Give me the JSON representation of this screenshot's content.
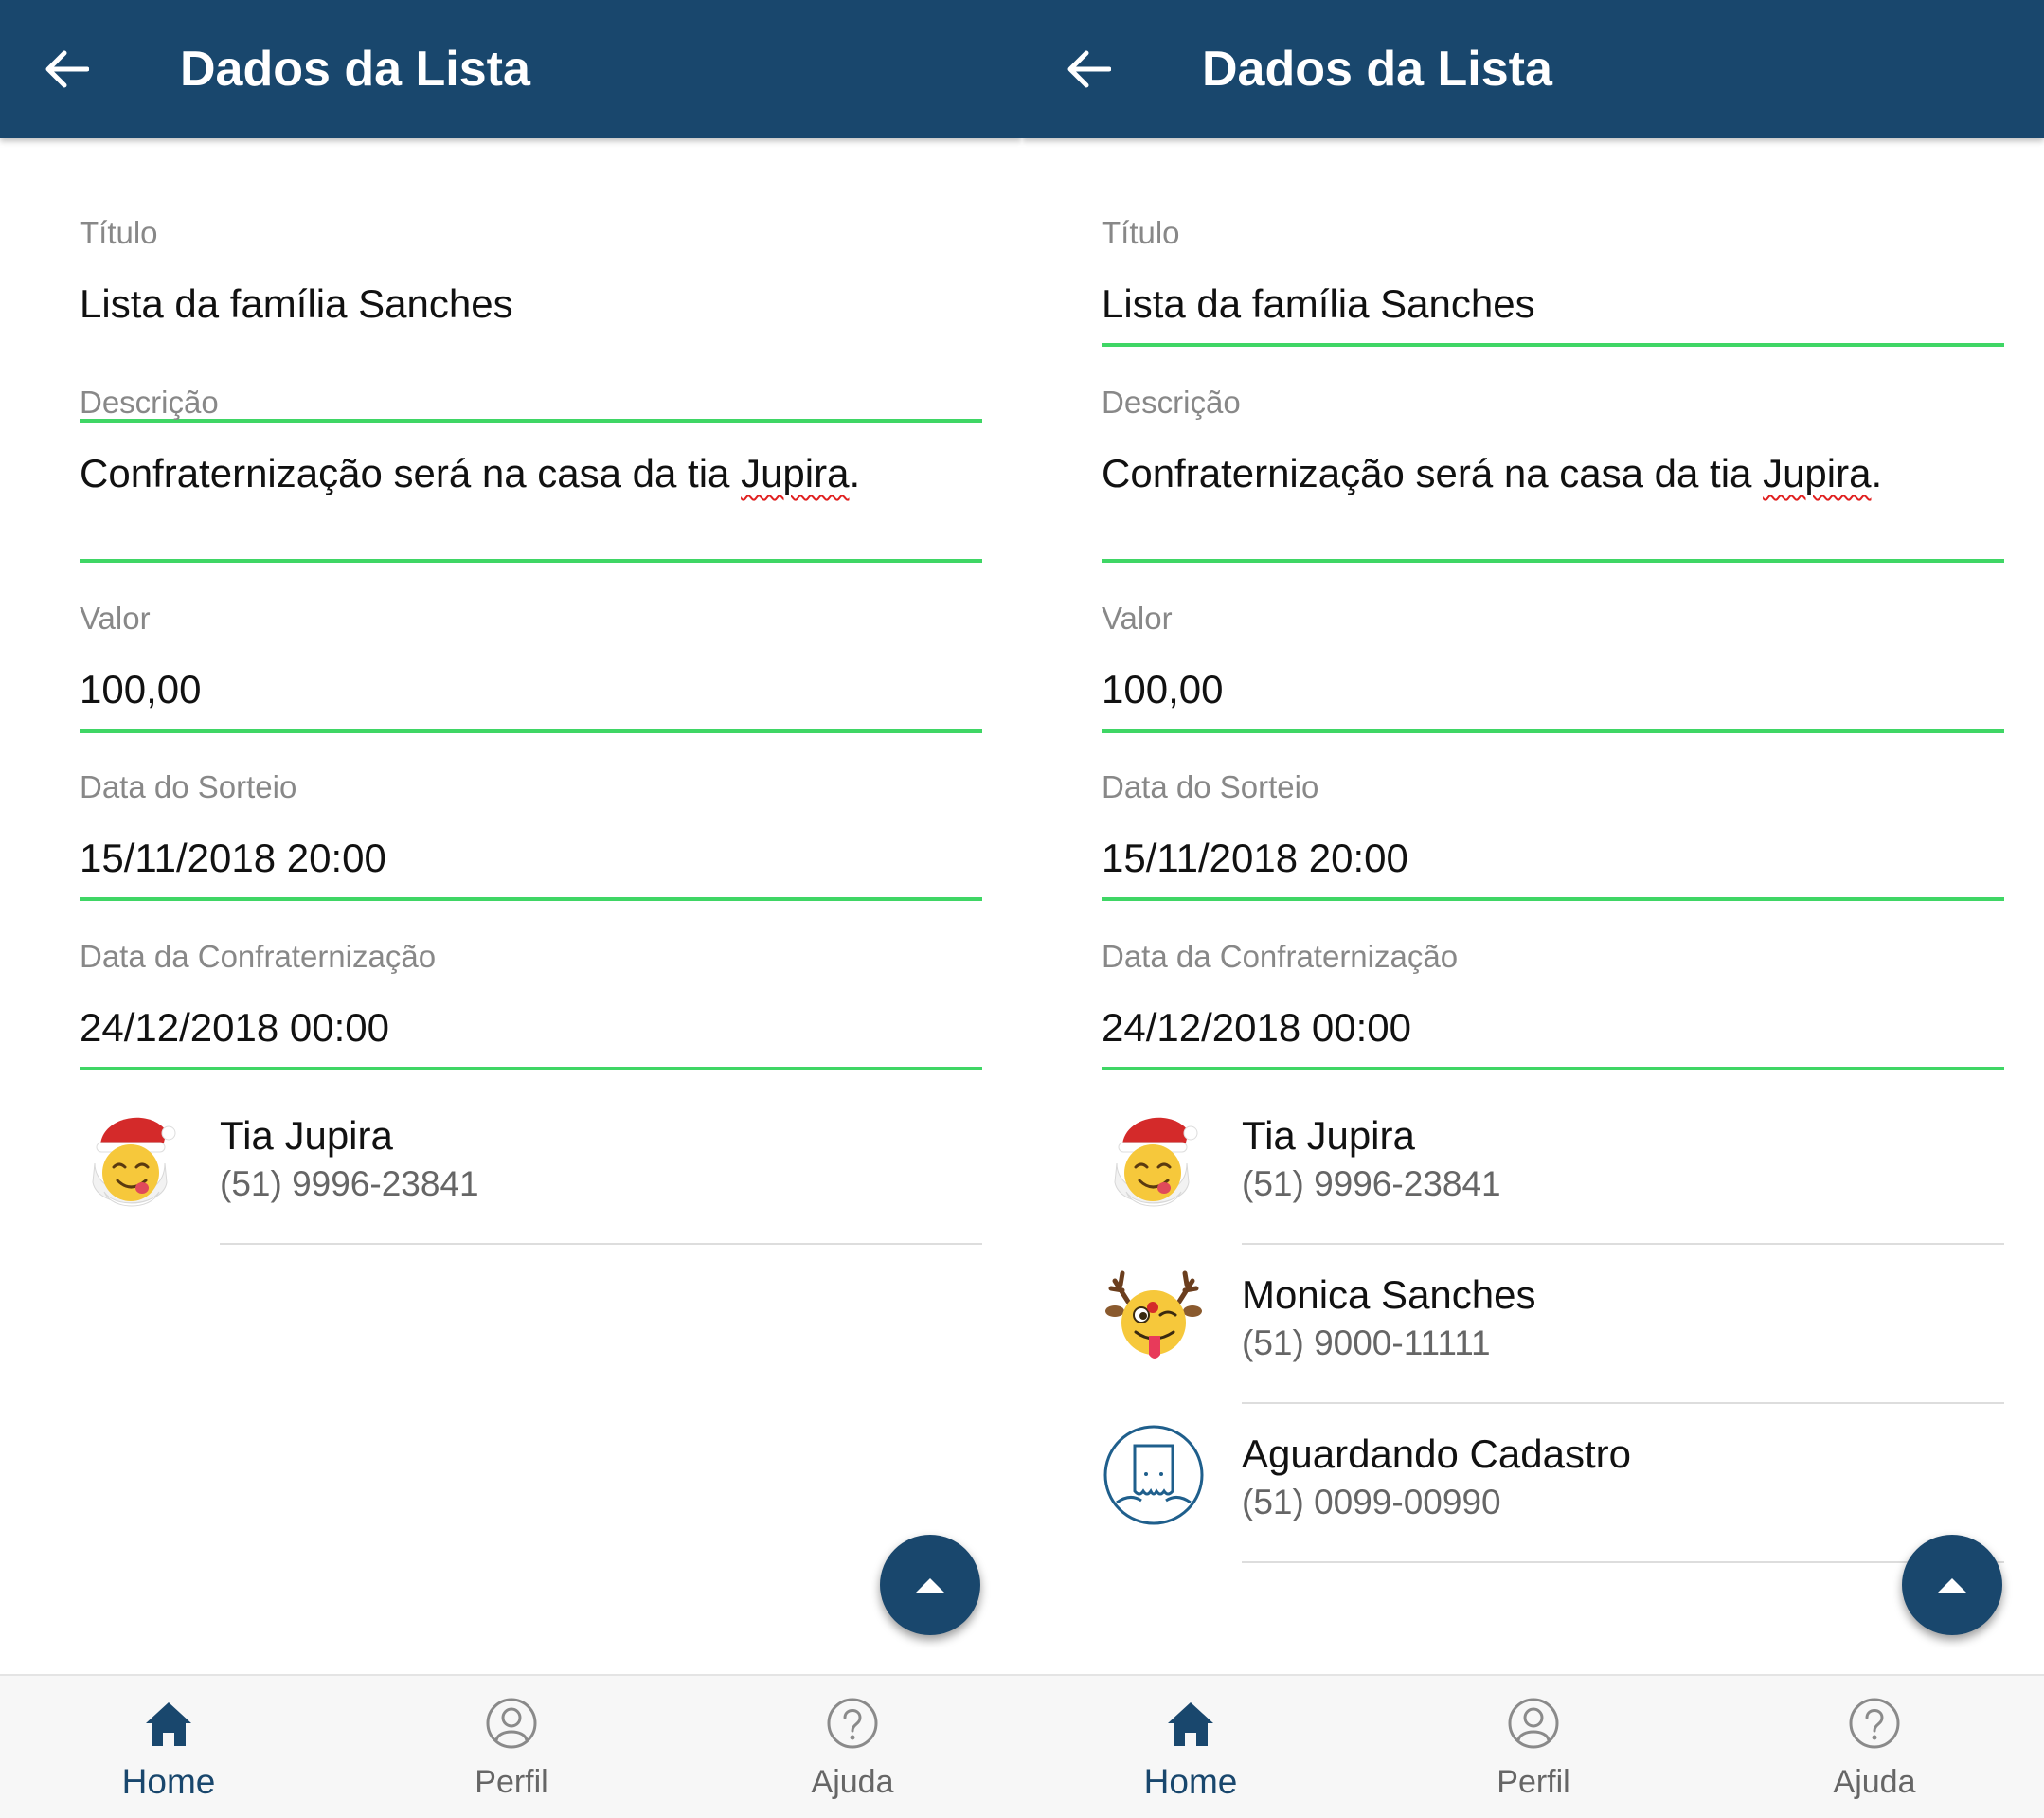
{
  "colors": {
    "appbar": "#19476d",
    "accent_underline": "#3fd665",
    "fab": "#19476d",
    "nav_active": "#19476d",
    "nav_inactive": "#666666"
  },
  "screens": [
    {
      "appbar": {
        "back_icon": "arrow-left-icon",
        "title": "Dados da Lista"
      },
      "form": {
        "titulo": {
          "label": "Título",
          "value": "Lista da família Sanches"
        },
        "descricao": {
          "label": "Descrição",
          "value_prefix": "Confraternização será na casa da tia ",
          "value_flagged": "Jupira",
          "value_suffix": "."
        },
        "valor": {
          "label": "Valor",
          "value": "100,00"
        },
        "data_sorteio": {
          "label": "Data do Sorteio",
          "value": "15/11/2018 20:00"
        },
        "data_confraternizacao": {
          "label": "Data da Confraternização",
          "value": "24/12/2018 00:00"
        }
      },
      "members": [
        {
          "name": "Tia Jupira",
          "phone": "(51) 9996-23841",
          "avatar": "santa-emoji-avatar-icon"
        }
      ],
      "fab": {
        "icon": "caret-up-icon"
      },
      "bottom_nav": [
        {
          "label": "Home",
          "icon": "home-icon",
          "active": true
        },
        {
          "label": "Perfil",
          "icon": "profile-icon",
          "active": false
        },
        {
          "label": "Ajuda",
          "icon": "help-icon",
          "active": false
        }
      ]
    },
    {
      "appbar": {
        "back_icon": "arrow-left-icon",
        "title": "Dados da Lista"
      },
      "form": {
        "titulo": {
          "label": "Título",
          "value": "Lista da família Sanches"
        },
        "descricao": {
          "label": "Descrição",
          "value_prefix": "Confraternização será na casa da tia ",
          "value_flagged": "Jupira",
          "value_suffix": "."
        },
        "valor": {
          "label": "Valor",
          "value": "100,00"
        },
        "data_sorteio": {
          "label": "Data do Sorteio",
          "value": "15/11/2018 20:00"
        },
        "data_confraternizacao": {
          "label": "Data da Confraternização",
          "value": "24/12/2018 00:00"
        }
      },
      "members": [
        {
          "name": "Tia Jupira",
          "phone": "(51) 9996-23841",
          "avatar": "santa-emoji-avatar-icon"
        },
        {
          "name": "Monica Sanches",
          "phone": "(51) 9000-11111",
          "avatar": "reindeer-emoji-avatar-icon"
        },
        {
          "name": "Aguardando Cadastro",
          "phone": "(51) 0099-00990",
          "avatar": "placeholder-avatar-icon"
        }
      ],
      "fab": {
        "icon": "caret-up-icon"
      },
      "bottom_nav": [
        {
          "label": "Home",
          "icon": "home-icon",
          "active": true
        },
        {
          "label": "Perfil",
          "icon": "profile-icon",
          "active": false
        },
        {
          "label": "Ajuda",
          "icon": "help-icon",
          "active": false
        }
      ]
    }
  ]
}
